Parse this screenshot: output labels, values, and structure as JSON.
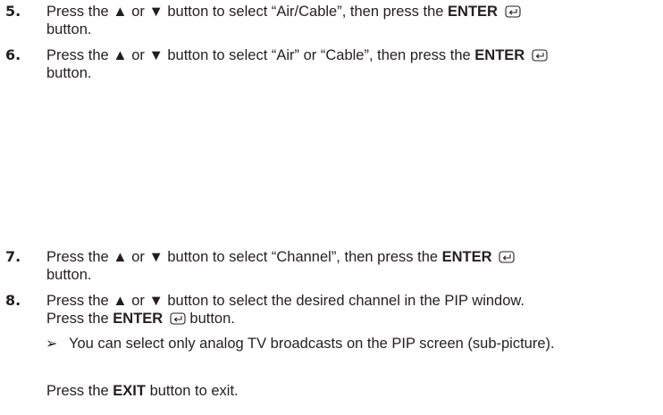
{
  "steps": [
    {
      "number": "5.",
      "text_before": "Press the ▲ or ▼ button to select “Air/Cable”, then press the ",
      "bold": "ENTER",
      "icon": "enter-icon",
      "text_after": "button."
    },
    {
      "number": "6.",
      "text_before": "Press the ▲ or ▼ button to select “Air” or “Cable”, then press the ",
      "bold": "ENTER",
      "icon": "enter-icon",
      "text_after": "button."
    },
    {
      "number": "7.",
      "text_before": "Press the ▲ or ▼ button to select “Channel”, then press the ",
      "bold": "ENTER",
      "icon": "enter-icon",
      "text_after": "button."
    },
    {
      "number": "8.",
      "line1": "Press the ▲ or ▼ button to select the desired channel in the PIP window.",
      "line2_before": "Press the ",
      "bold": "ENTER",
      "icon": "enter-icon",
      "line2_after": " button."
    }
  ],
  "note": {
    "icon": "arrowhead-note-icon",
    "symbol": "➢",
    "text": "You can select only analog TV broadcasts on the PIP screen (sub-picture)."
  },
  "final": {
    "before": "Press the ",
    "bold": "EXIT",
    "after": " button to exit."
  }
}
